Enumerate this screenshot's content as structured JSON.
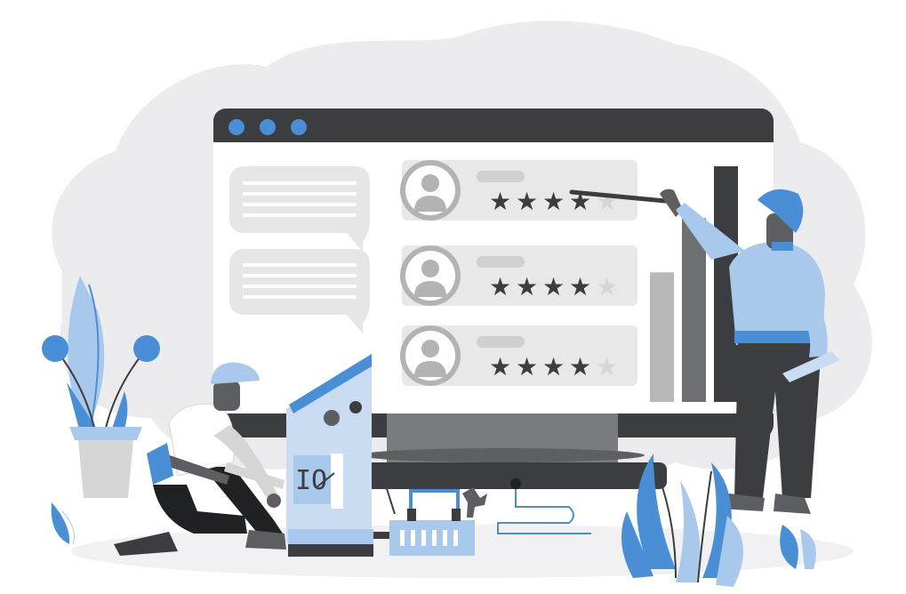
{
  "colors": {
    "blob": "#ececee",
    "ground": "#f1f1f3",
    "monitor_dark": "#3b3d40",
    "screen": "#ffffff",
    "card": "#e8e8e8",
    "bubble": "#e6e6e6",
    "avatar": "#b3b3b3",
    "line": "#ffffff",
    "star_filled": "#3b3d40",
    "star_empty": "#d6d6d6",
    "accent_blue": "#4a8fd6",
    "light_blue": "#a9c9ec",
    "pale_blue": "#c9dcf2",
    "bar_light": "#b8b8b8",
    "bar_mid": "#6e6f72",
    "bar_dark": "#3b3d40",
    "skin": "#5c5e61",
    "pants": "#1f2124"
  },
  "window": {
    "dots": [
      "window-dot-1",
      "window-dot-2",
      "window-dot-3"
    ]
  },
  "reviews": [
    {
      "rating": 4,
      "max": 5
    },
    {
      "rating": 4,
      "max": 5
    },
    {
      "rating": 4,
      "max": 5
    }
  ],
  "bar_chart": {
    "values": [
      0.55,
      0.78,
      1.0
    ]
  },
  "icons": {
    "avatar": "user-avatar-icon",
    "star": "star-icon",
    "wrench": "wrench-icon",
    "toolbox": "toolbox-icon",
    "plant": "plant-icon"
  }
}
